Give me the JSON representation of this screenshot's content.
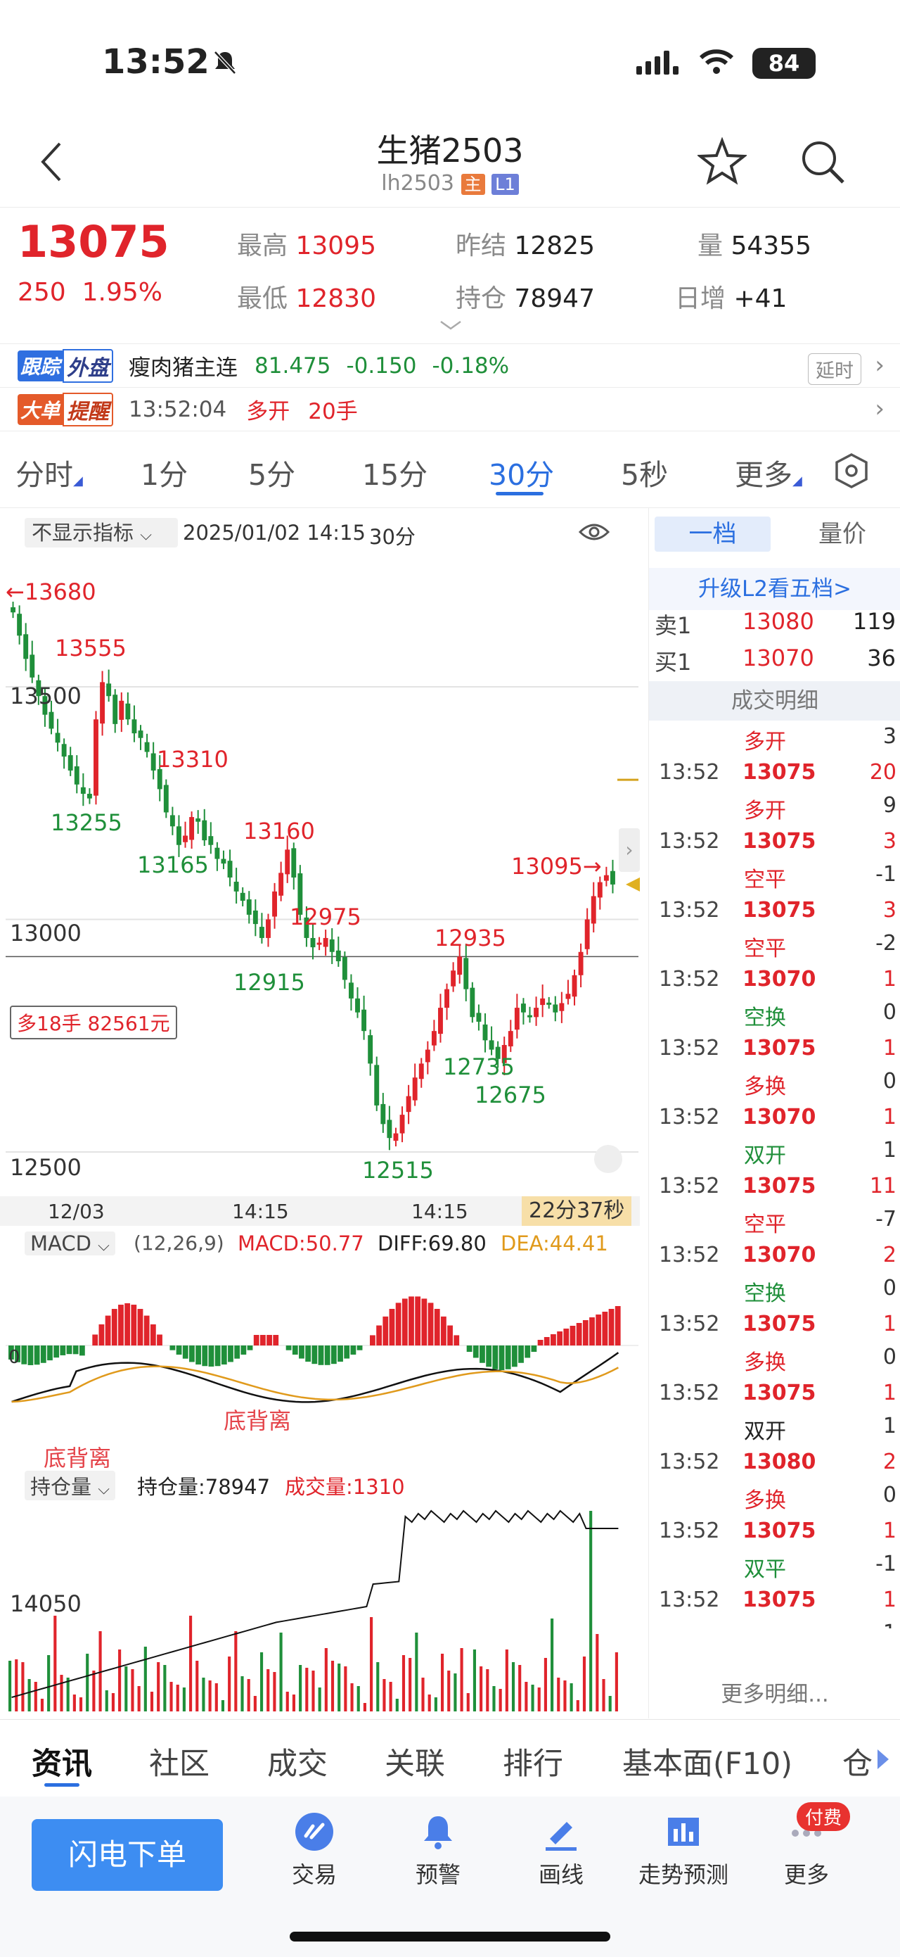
{
  "status": {
    "time": "13:52",
    "battery": "84"
  },
  "nav": {
    "title": "生猪2503",
    "code": "lh2503",
    "badge_main": "主",
    "badge_level": "L1"
  },
  "quote": {
    "last": "13075",
    "change": "250",
    "change_pct": "1.95%",
    "high_label": "最高",
    "high": "13095",
    "low_label": "最低",
    "low": "12830",
    "prev_settle_label": "昨结",
    "prev_settle": "12825",
    "oi_label": "持仓",
    "oi": "78947",
    "vol_label": "量",
    "vol": "54355",
    "day_inc_label": "日增",
    "day_inc": "+41"
  },
  "track": {
    "badge1": "跟踪",
    "badge2": "外盘",
    "name": "瘦肉猪主连",
    "price": "81.475",
    "chg": "-0.150",
    "pct": "-0.18%",
    "delay": "延时"
  },
  "alert": {
    "badge1": "大单",
    "badge2": "提醒",
    "time": "13:52:04",
    "action": "多开",
    "qty": "20手"
  },
  "periods": [
    "分时",
    "1分",
    "5分",
    "15分",
    "30分",
    "5秒",
    "更多"
  ],
  "active_period": "30分",
  "chart_header": {
    "indicator": "不显示指标",
    "datetime": "2025/01/02 14:15",
    "period": "30分"
  },
  "kline": {
    "y_ticks": [
      "13500",
      "13000",
      "12500"
    ],
    "labels": {
      "max": "←13680",
      "a": "13555",
      "b": "13255",
      "c": "13310",
      "d": "13165",
      "e": "13160",
      "f": "12915",
      "g": "12975",
      "h": "12515",
      "i": "12935",
      "j": "12735",
      "k": "12675",
      "last": "13095→"
    },
    "position_tag": "多18手 82561元",
    "x_ticks": [
      "12/03",
      "14:15",
      "14:15"
    ],
    "countdown": "22分37秒",
    "series_close": [
      13660,
      13610,
      13560,
      13520,
      13480,
      13440,
      13410,
      13380,
      13350,
      13320,
      13290,
      13270,
      13260,
      13430,
      13510,
      13480,
      13420,
      13470,
      13430,
      13400,
      13390,
      13360,
      13320,
      13280,
      13230,
      13200,
      13160,
      13180,
      13220,
      13210,
      13170,
      13160,
      13130,
      13120,
      13090,
      13060,
      13040,
      13010,
      12990,
      12960,
      13000,
      13060,
      13100,
      13150,
      13090,
      13010,
      12960,
      12940,
      12950,
      12960,
      12930,
      12910,
      12870,
      12830,
      12800,
      12760,
      12690,
      12600,
      12560,
      12530,
      12540,
      12580,
      12620,
      12660,
      12690,
      12720,
      12760,
      12810,
      12850,
      12890,
      12920,
      12850,
      12790,
      12780,
      12740,
      12720,
      12700,
      12730,
      12760,
      12810,
      12800,
      12790,
      12810,
      12830,
      12820,
      12800,
      12820,
      12840,
      12880,
      12930,
      13000,
      13050,
      13080,
      13095,
      13075
    ]
  },
  "macd": {
    "indicator": "MACD",
    "params": "(12,26,9)",
    "macd_label": "MACD:50.77",
    "diff_label": "DIFF:69.80",
    "dea_label": "DEA:44.41",
    "zero": "0",
    "div1": "底背离",
    "div2": "底背离"
  },
  "oi_panel": {
    "indicator": "持仓量",
    "oi_label": "持仓量:78947",
    "vol_label": "成交量:1310",
    "y_tick": "14050"
  },
  "side": {
    "tab1": "一档",
    "tab2": "量价",
    "upgrade": "升级L2看五档>",
    "ask_label": "卖1",
    "ask": "13080",
    "ask_vol": "119",
    "bid_label": "买1",
    "bid": "13070",
    "bid_vol": "36",
    "detail_title": "成交明细",
    "more": "更多明细...",
    "trades": [
      {
        "t": "",
        "p": "",
        "v": "",
        "k": "多开",
        "d": "3",
        "kc": "red"
      },
      {
        "t": "13:52",
        "p": "13075",
        "v": "20",
        "k": "多开",
        "d": "9",
        "kc": "red"
      },
      {
        "t": "13:52",
        "p": "13075",
        "v": "3",
        "k": "空平",
        "d": "-1",
        "kc": "red"
      },
      {
        "t": "13:52",
        "p": "13075",
        "v": "3",
        "k": "空平",
        "d": "-2",
        "kc": "red"
      },
      {
        "t": "13:52",
        "p": "13070",
        "v": "1",
        "k": "空换",
        "d": "0",
        "kc": "green"
      },
      {
        "t": "13:52",
        "p": "13075",
        "v": "1",
        "k": "多换",
        "d": "0",
        "kc": "red"
      },
      {
        "t": "13:52",
        "p": "13070",
        "v": "1",
        "k": "双开",
        "d": "1",
        "kc": "green"
      },
      {
        "t": "13:52",
        "p": "13075",
        "v": "11",
        "k": "空平",
        "d": "-7",
        "kc": "red"
      },
      {
        "t": "13:52",
        "p": "13070",
        "v": "2",
        "k": "空换",
        "d": "0",
        "kc": "green"
      },
      {
        "t": "13:52",
        "p": "13075",
        "v": "1",
        "k": "多换",
        "d": "0",
        "kc": "red"
      },
      {
        "t": "13:52",
        "p": "13075",
        "v": "1",
        "k": "双开",
        "d": "1",
        "kc": "black"
      },
      {
        "t": "13:52",
        "p": "13080",
        "v": "2",
        "k": "多换",
        "d": "0",
        "kc": "red"
      },
      {
        "t": "13:52",
        "p": "13075",
        "v": "1",
        "k": "双平",
        "d": "-1",
        "kc": "green"
      },
      {
        "t": "13:52",
        "p": "13075",
        "v": "1",
        "k": "双开",
        "d": "1",
        "kc": "black"
      }
    ]
  },
  "bottom_tabs": [
    "资讯",
    "社区",
    "成交",
    "关联",
    "排行",
    "基本面(F10)",
    "仓"
  ],
  "toolbar": {
    "order": "闪电下单",
    "trade": "交易",
    "alert": "预警",
    "draw": "画线",
    "predict": "走势预测",
    "more": "更多",
    "paid": "付费"
  },
  "colors": {
    "up": "#e0242b",
    "down": "#1f8f3a",
    "accent": "#2b6fe0"
  }
}
